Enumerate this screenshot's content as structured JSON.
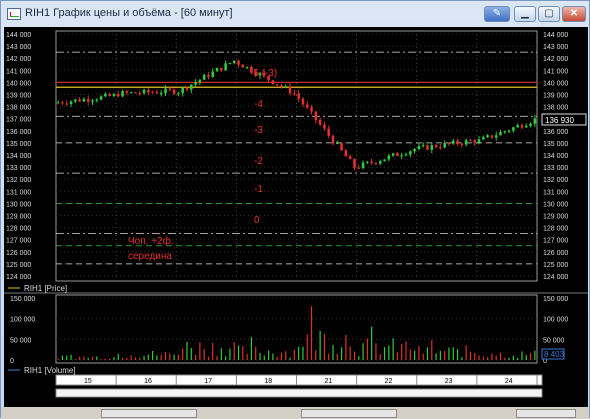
{
  "window": {
    "title": "RIH1 График цены и объёма - [60 минут]",
    "buttons": {
      "pin": "✎",
      "minimize": "▁",
      "maximize": "▢",
      "close": "✕"
    }
  },
  "price_panel": {
    "legend": "RIH1 [Price]",
    "y_ticks": [
      "144 000",
      "143 000",
      "142 000",
      "141 000",
      "140 000",
      "139 000",
      "138 000",
      "137 000",
      "136 000",
      "135 000",
      "134 000",
      "133 000",
      "132 000",
      "131 000",
      "130 000",
      "129 000",
      "128 000",
      "127 000",
      "126 000",
      "125 000",
      "124 000"
    ],
    "current_price": "136 930",
    "wave_labels": [
      "-5 (-3)",
      "-4",
      "-3",
      "-2",
      "-1",
      "0"
    ],
    "note_lines": [
      "Чоп. +2ф.",
      "середина"
    ]
  },
  "volume_panel": {
    "legend": "RIH1 [Volume]",
    "y_ticks": [
      "150 000",
      "100 000",
      "50 000",
      "0"
    ],
    "current_volume": "8 403"
  },
  "date_axis": {
    "labels": [
      "15",
      "16",
      "17",
      "18",
      "21",
      "22",
      "23",
      "24"
    ]
  },
  "colors": {
    "up": "#2ecc40",
    "down": "#e03030",
    "background": "#000000",
    "grid": "#555555",
    "accent_line": "#e0c020"
  },
  "chart_data": {
    "type": "candlestick",
    "title": "RIH1",
    "timeframe": "60 минут",
    "ylim": [
      124000,
      144000
    ],
    "volume_ylim": [
      0,
      150000
    ],
    "categories": [
      "15",
      "16",
      "17",
      "18",
      "21",
      "22",
      "23",
      "24"
    ],
    "series": [
      {
        "name": "Price",
        "close_by_day": [
          138900,
          139300,
          141800,
          139100,
          133000,
          134500,
          135200,
          136930
        ]
      },
      {
        "name": "Volume",
        "peak_by_day": [
          20000,
          40000,
          90000,
          60000,
          150000,
          90000,
          60000,
          40000
        ]
      }
    ],
    "levels": [
      {
        "value": 142500,
        "style": "dash-dot",
        "color": "#dcdcdc"
      },
      {
        "value": 140000,
        "style": "solid",
        "color": "#c03030"
      },
      {
        "value": 139600,
        "style": "solid",
        "color": "#e0c020"
      },
      {
        "value": 137200,
        "style": "dash-dot",
        "color": "#dcdcdc"
      },
      {
        "value": 135000,
        "style": "dash",
        "color": "#dcdcdc"
      },
      {
        "value": 132500,
        "style": "dash-dot",
        "color": "#dcdcdc"
      },
      {
        "value": 130000,
        "style": "dash",
        "color": "#2ecc40"
      },
      {
        "value": 127500,
        "style": "dash-dot",
        "color": "#dcdcdc"
      },
      {
        "value": 126500,
        "style": "dash",
        "color": "#2ecc40"
      },
      {
        "value": 125000,
        "style": "dash",
        "color": "#dcdcdc"
      }
    ],
    "grid": true
  }
}
